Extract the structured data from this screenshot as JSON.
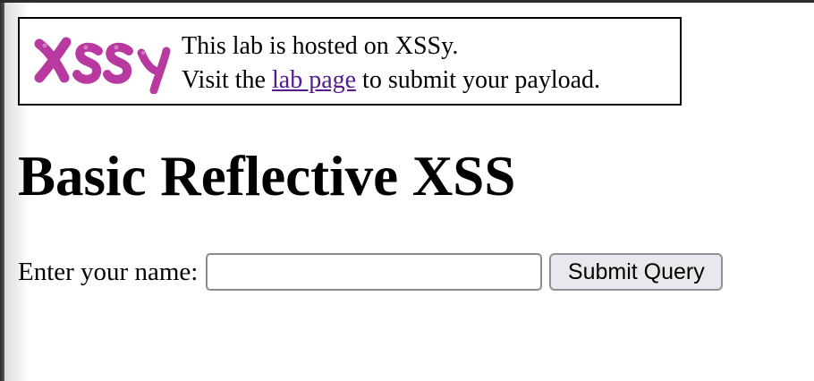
{
  "banner": {
    "logo_text": "XSSy",
    "line1": "This lab is hosted on XSSy.",
    "line2_before": "Visit the ",
    "link_text": "lab page",
    "line2_after": " to submit your payload."
  },
  "heading": "Basic Reflective XSS",
  "form": {
    "label": "Enter your name:",
    "input_value": "",
    "submit_label": "Submit Query"
  },
  "colors": {
    "logo": "#b83aa0",
    "link": "#551a8b"
  }
}
